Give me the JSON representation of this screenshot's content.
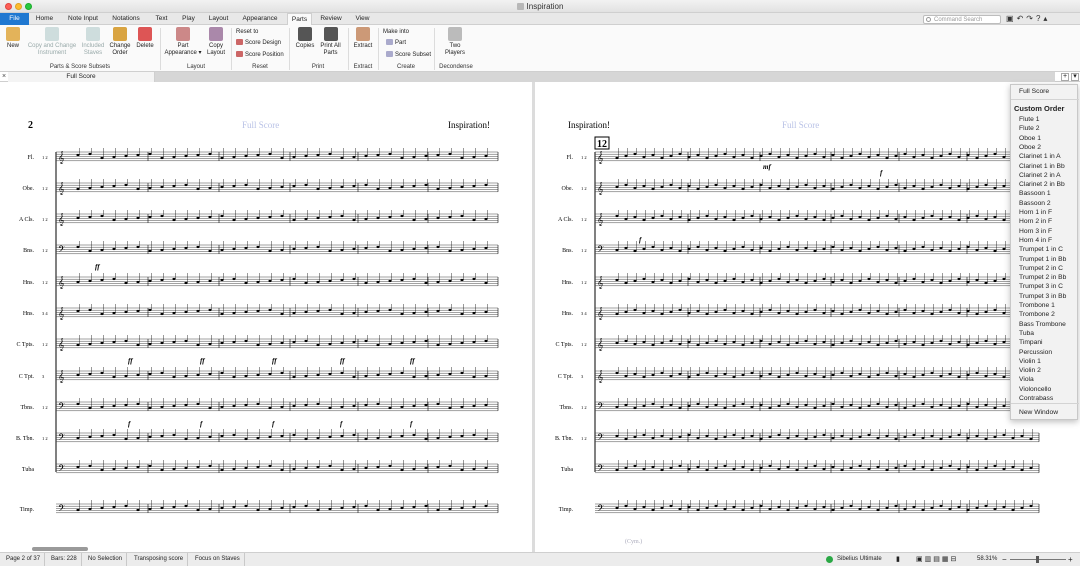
{
  "window": {
    "title": "Inspiration"
  },
  "tabs": {
    "file": "File",
    "home": "Home",
    "note_input": "Note Input",
    "notations": "Notations",
    "text": "Text",
    "play": "Play",
    "layout": "Layout",
    "appearance": "Appearance",
    "parts": "Parts",
    "review": "Review",
    "view": "View"
  },
  "search": {
    "placeholder": "Command Search"
  },
  "ribbon": {
    "new": "New",
    "copy_change_1": "Copy and Change",
    "copy_change_2": "Instrument",
    "included_1": "Included",
    "included_2": "Staves",
    "change_order_1": "Change",
    "change_order_2": "Order",
    "delete": "Delete",
    "part_app_1": "Part",
    "part_app_2": "Appearance",
    "copy_layout_1": "Copy",
    "copy_layout_2": "Layout",
    "reset_to": "Reset to",
    "score_design": "Score Design",
    "score_position": "Score Position",
    "copies": "Copies",
    "print_all_1": "Print All",
    "print_all_2": "Parts",
    "extract": "Extract",
    "make_into": "Make into",
    "part": "Part",
    "score_subset": "Score Subset",
    "two_players_1": "Two",
    "two_players_2": "Players",
    "groups": {
      "parts_subsets": "Parts & Score Subsets",
      "layout": "Layout",
      "reset": "Reset",
      "print": "Print",
      "extract": "Extract",
      "create": "Create",
      "decondense": "Decondense"
    }
  },
  "doc_tab": "Full Score",
  "score": {
    "left_page_num": "2",
    "left_header": "Full Score",
    "left_title": "Inspiration!",
    "right_title": "Inspiration!",
    "right_header": "Full Score",
    "right_bar_num": "12",
    "staves": [
      "Fl.",
      "Obe.",
      "A Cls.",
      "Bns.",
      "Hns.",
      "Hns.",
      "C Tpts.",
      "C Tpt.",
      "Tbns.",
      "B. Tbn.",
      "Tuba",
      "Timp."
    ],
    "staff_nums": [
      "1 2",
      "1 2",
      "1 2",
      "1 2",
      "1 2",
      "3 4",
      "1 2",
      "3",
      "1 2",
      "1 2",
      "",
      ""
    ],
    "dyn_ff": "ff",
    "dyn_mf": "mf",
    "dyn_f": "f",
    "cym": "(Cym.)"
  },
  "dropdown": {
    "full_score": "Full Score",
    "custom_order": "Custom Order",
    "items": [
      "Flute 1",
      "Flute 2",
      "Oboe 1",
      "Oboe 2",
      "Clarinet 1 in A",
      "Clarinet 1 in Bb",
      "Clarinet 2 in A",
      "Clarinet 2 in Bb",
      "Bassoon 1",
      "Bassoon 2",
      "Horn 1 in F",
      "Horn 2 in F",
      "Horn 3 in F",
      "Horn 4 in F",
      "Trumpet 1 in C",
      "Trumpet 1 in Bb",
      "Trumpet 2 in C",
      "Trumpet 2 in Bb",
      "Trumpet 3 in C",
      "Trumpet 3 in Bb",
      "Trombone 1",
      "Trombone 2",
      "Bass Trombone",
      "Tuba",
      "Timpani",
      "Percussion",
      "Violin 1",
      "Violin 2",
      "Viola",
      "Violoncello",
      "Contrabass"
    ],
    "new_window": "New Window"
  },
  "status": {
    "page": "Page 2 of 37",
    "bars": "Bars: 228",
    "selection": "No Selection",
    "transposing": "Transposing score",
    "focus": "Focus on Staves",
    "edition": "Sibelius Ultimate",
    "zoom": "58.31%"
  }
}
